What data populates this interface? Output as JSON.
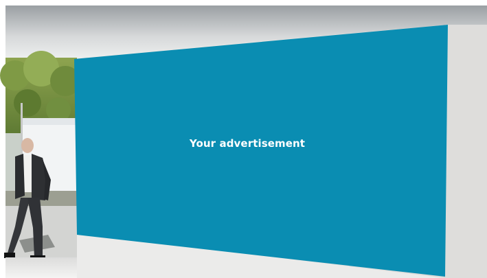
{
  "advertisement": {
    "text": "Your advertisement",
    "panel_color": "#0a8db2"
  }
}
